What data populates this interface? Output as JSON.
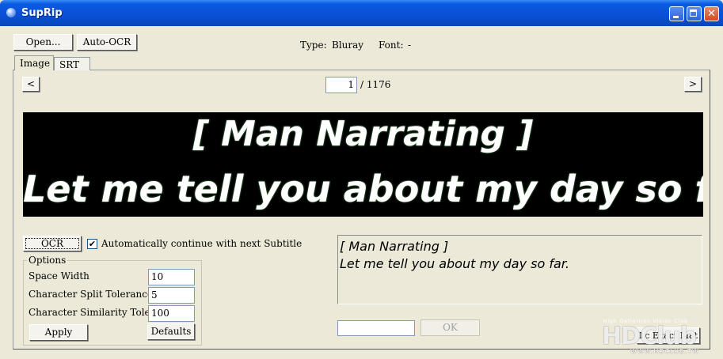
{
  "window": {
    "title": "SupRip"
  },
  "toolbar": {
    "open_label": "Open...",
    "auto_ocr_label": "Auto-OCR"
  },
  "info": {
    "type_label": "Type:",
    "type_value": "Bluray",
    "font_label": "Font:",
    "font_value": "-"
  },
  "tabs": [
    {
      "label": "Image"
    },
    {
      "label": "SRT"
    }
  ],
  "nav": {
    "prev_label": "<",
    "next_label": ">",
    "current": "1",
    "total": "/ 1176"
  },
  "subtitle_image": {
    "line1": "[ Man Narrating ]",
    "line2": "Let me tell you about my day so far."
  },
  "ocr": {
    "button_label": "OCR",
    "auto_continue_label": "Automatically continue with next Subtitle",
    "auto_continue_checked": "✔"
  },
  "options": {
    "legend": "Options",
    "space_width_label": "Space Width",
    "space_width_value": "10",
    "split_tolerance_label": "Character Split Tolerance",
    "split_tolerance_value": "5",
    "similarity_tolerance_label": "Character Similarity Tolerance",
    "similarity_tolerance_value": "100",
    "apply_label": "Apply",
    "defaults_label": "Defaults"
  },
  "result": {
    "line1": "[ Man Narrating ]",
    "line2": "Let me tell you about my day so far."
  },
  "letter": {
    "input_value": "",
    "ok_label": "OK",
    "hidden_button_label": "Lc Exact Mat"
  },
  "watermark": {
    "small": "High Definition Vision Club",
    "big": "HDClub",
    "url": "WWW.HDCLUB.TW"
  }
}
